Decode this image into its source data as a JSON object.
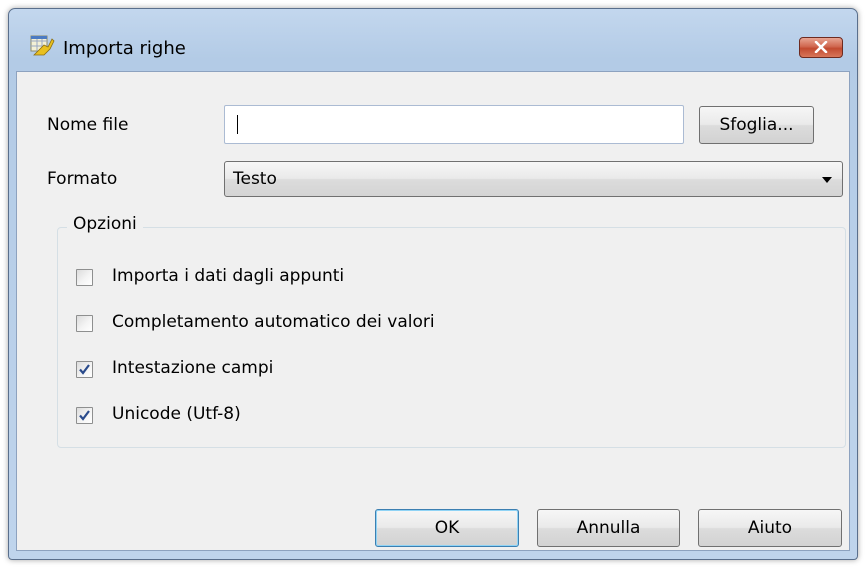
{
  "window": {
    "title": "Importa righe",
    "icon": "import-rows-icon",
    "close_icon": "close-icon"
  },
  "form": {
    "filename_label": "Nome file",
    "filename_value": "",
    "browse_label": "Sfoglia...",
    "format_label": "Formato",
    "format_value": "Testo"
  },
  "options": {
    "group_label": "Opzioni",
    "items": [
      {
        "label": "Importa i dati dagli appunti",
        "checked": false
      },
      {
        "label": "Completamento automatico dei valori",
        "checked": false
      },
      {
        "label": "Intestazione campi",
        "checked": true
      },
      {
        "label": "Unicode (Utf-8)",
        "checked": true
      }
    ]
  },
  "buttons": {
    "ok": "OK",
    "cancel": "Annulla",
    "help": "Aiuto"
  },
  "colors": {
    "close_button": "#c9553b",
    "checkmark": "#2a4b8c",
    "default_button_border": "#3c7fb1"
  }
}
